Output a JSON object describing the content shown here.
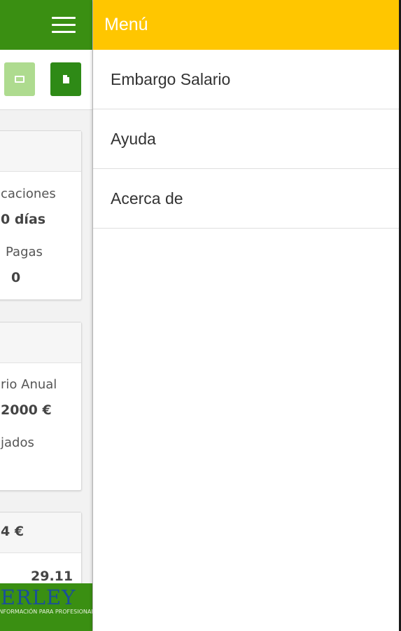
{
  "drawer": {
    "title": "Menú",
    "items": [
      {
        "label": "Embargo Salario"
      },
      {
        "label": "Ayuda"
      },
      {
        "label": "Acerca de"
      }
    ]
  },
  "background": {
    "card1": {
      "vacaciones_label": "caciones",
      "vacaciones_value": "0 días",
      "pagas_label": "Pagas",
      "pagas_value": "0"
    },
    "card2": {
      "salario_label": "rio Anual",
      "salario_value": "2000 €",
      "trabajados_label": "jados"
    },
    "card3": {
      "header_value": "4 €",
      "row_value": "29.11"
    },
    "logo": {
      "name": "IBERLEY",
      "tagline": "INFORMACIÓN PARA PROFESIONALES"
    }
  },
  "colors": {
    "app_green": "#3a8f12",
    "drawer_header": "#ffc600",
    "mail_button": "#aedb8f",
    "doc_button": "#2e8a16"
  },
  "icons": {
    "menu": "hamburger-icon",
    "mail": "mail-icon",
    "doc": "document-icon"
  }
}
